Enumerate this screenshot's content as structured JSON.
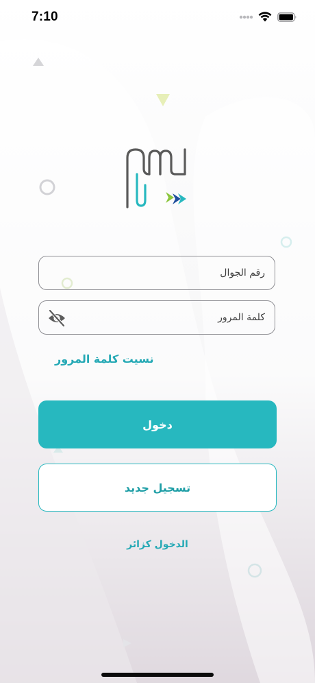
{
  "status_bar": {
    "time": "7:10"
  },
  "login_form": {
    "phone_placeholder": "رقم الجوال",
    "password_placeholder": "كلمة المرور",
    "forgot_password": "نسيت كلمة المرور",
    "login_label": "دخول",
    "register_label": "تسجيل جديد",
    "guest_label": "الدخول كزائر"
  },
  "colors": {
    "accent": "#27b8bf",
    "link": "#25a9b5",
    "logo_text": "#5a5a5a",
    "logo_mark_green": "#8cc63f",
    "logo_mark_blue": "#1f4e9c"
  },
  "icons": {
    "status": [
      "signal-dots-icon",
      "wifi-icon",
      "battery-icon"
    ],
    "password_toggle": "eye-slash-icon",
    "logo_mark": "chevron-arrows-icon"
  }
}
